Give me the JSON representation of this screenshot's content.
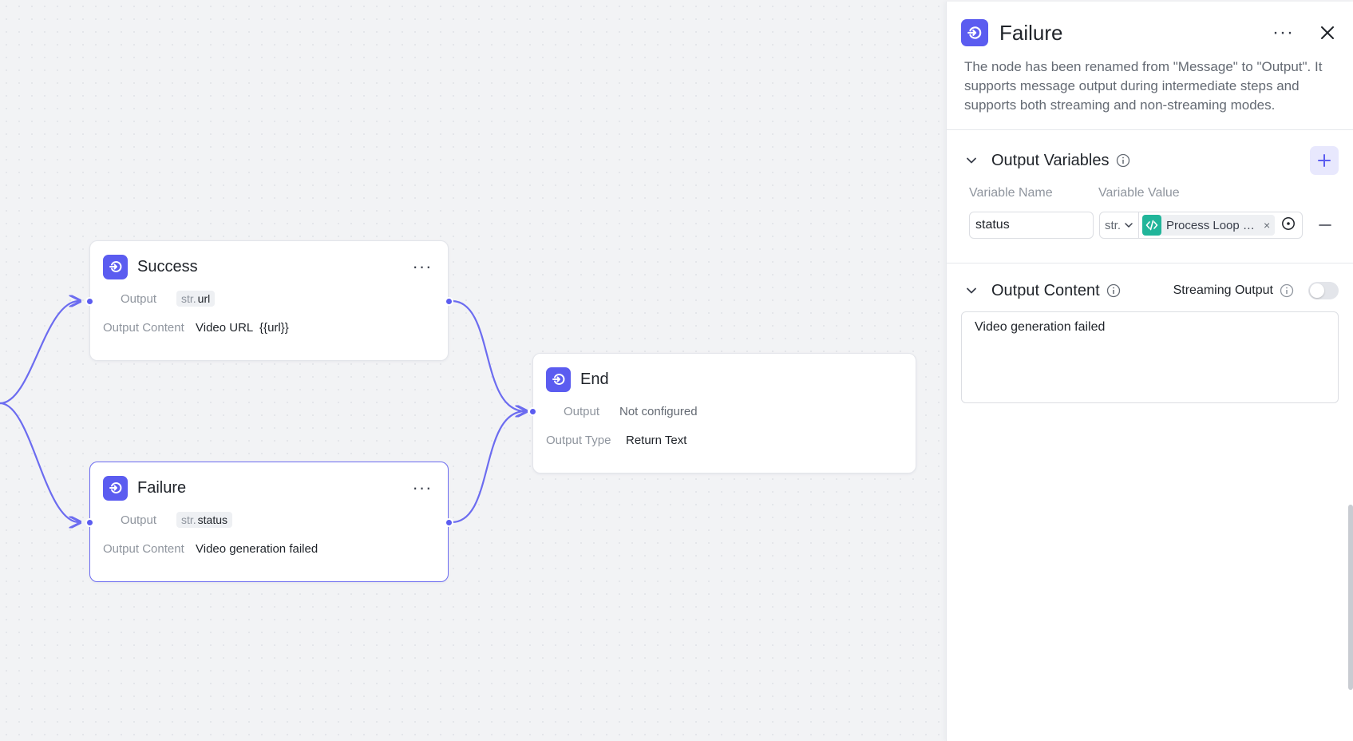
{
  "colors": {
    "accent": "#5b5cf0",
    "edge": "#6c6cf0",
    "ref_icon": "#21b59a"
  },
  "nodes": {
    "success": {
      "title": "Success",
      "output_label": "Output",
      "output_type": "str.",
      "output_var": "url",
      "content_label": "Output Content",
      "content_value": "Video URL  {{url}}"
    },
    "failure": {
      "title": "Failure",
      "output_label": "Output",
      "output_type": "str.",
      "output_var": "status",
      "content_label": "Output Content",
      "content_value": "Video generation failed"
    },
    "end": {
      "title": "End",
      "output_label": "Output",
      "output_value": "Not configured",
      "type_label": "Output Type",
      "type_value": "Return Text"
    }
  },
  "panel": {
    "title": "Failure",
    "description": "The node has been renamed from \"Message\" to \"Output\". It supports message output during intermediate steps and supports both streaming and non-streaming modes.",
    "output_variables": {
      "title": "Output Variables",
      "col_name": "Variable Name",
      "col_value": "Variable Value",
      "rows": [
        {
          "name": "status",
          "type": "str.",
          "ref": "Process Loop Re..."
        }
      ]
    },
    "output_content": {
      "title": "Output Content",
      "streaming_label": "Streaming Output",
      "streaming_enabled": false,
      "text": "Video generation failed"
    }
  }
}
